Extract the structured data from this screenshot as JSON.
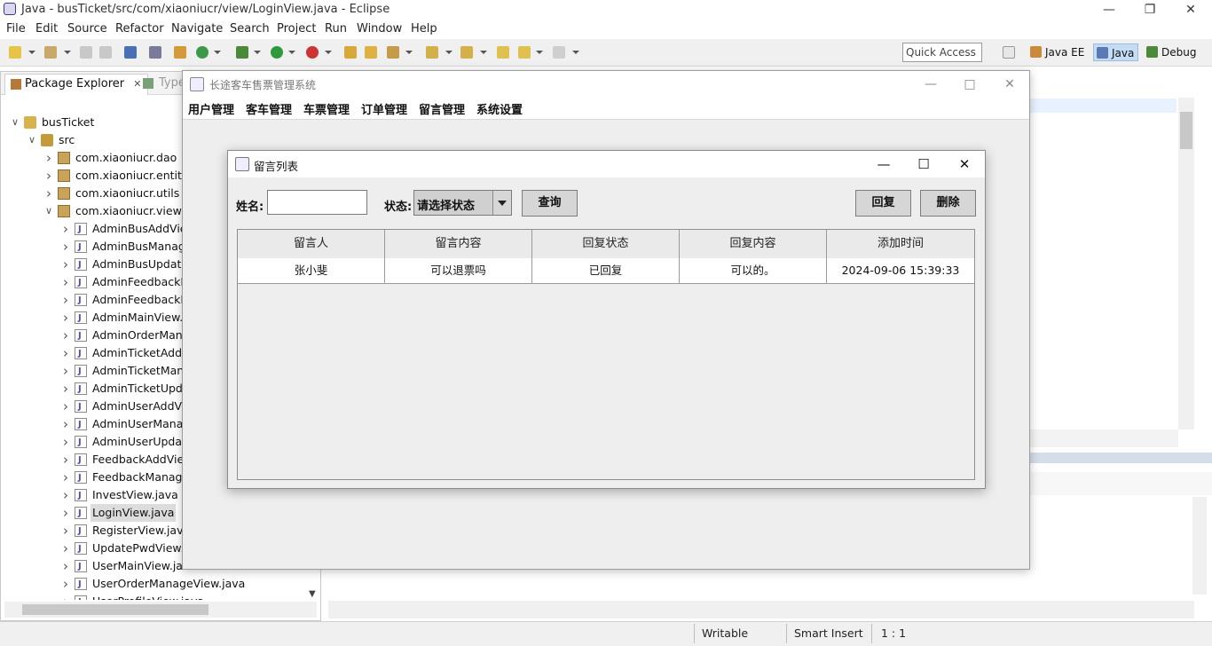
{
  "eclipse": {
    "window_title": "Java - busTicket/src/com/xiaoniucr/view/LoginView.java - Eclipse",
    "menu": [
      "File",
      "Edit",
      "Source",
      "Refactor",
      "Navigate",
      "Search",
      "Project",
      "Run",
      "Window",
      "Help"
    ],
    "quick_access": "Quick Access",
    "perspectives": [
      "Java EE",
      "Java",
      "Debug"
    ],
    "package_explorer": {
      "tab_label": "Package Explorer",
      "tab_close": "✕",
      "second_tab_label": "Type",
      "tree": [
        {
          "label": "busTicket",
          "level": 0,
          "expanded": true,
          "icon": "project-icon"
        },
        {
          "label": "src",
          "level": 1,
          "expanded": true,
          "icon": "source-folder-icon"
        },
        {
          "label": "com.xiaoniucr.dao",
          "level": 2,
          "expanded": false,
          "icon": "package-icon"
        },
        {
          "label": "com.xiaoniucr.entity",
          "level": 2,
          "expanded": false,
          "icon": "package-icon"
        },
        {
          "label": "com.xiaoniucr.utils",
          "level": 2,
          "expanded": false,
          "icon": "package-icon"
        },
        {
          "label": "com.xiaoniucr.view",
          "level": 2,
          "expanded": true,
          "icon": "package-icon"
        },
        {
          "label": "AdminBusAddVie",
          "level": 3,
          "expanded": false,
          "icon": "java-file-icon"
        },
        {
          "label": "AdminBusManag",
          "level": 3,
          "expanded": false,
          "icon": "java-file-icon"
        },
        {
          "label": "AdminBusUpdate",
          "level": 3,
          "expanded": false,
          "icon": "java-file-icon"
        },
        {
          "label": "AdminFeedbackM",
          "level": 3,
          "expanded": false,
          "icon": "java-file-icon"
        },
        {
          "label": "AdminFeedbackR",
          "level": 3,
          "expanded": false,
          "icon": "java-file-icon"
        },
        {
          "label": "AdminMainView.j",
          "level": 3,
          "expanded": false,
          "icon": "java-file-icon"
        },
        {
          "label": "AdminOrderMana",
          "level": 3,
          "expanded": false,
          "icon": "java-file-icon"
        },
        {
          "label": "AdminTicketAddV",
          "level": 3,
          "expanded": false,
          "icon": "java-file-icon"
        },
        {
          "label": "AdminTicketMana",
          "level": 3,
          "expanded": false,
          "icon": "java-file-icon"
        },
        {
          "label": "AdminTicketUpda",
          "level": 3,
          "expanded": false,
          "icon": "java-file-icon"
        },
        {
          "label": "AdminUserAddVi",
          "level": 3,
          "expanded": false,
          "icon": "java-file-icon"
        },
        {
          "label": "AdminUserManag",
          "level": 3,
          "expanded": false,
          "icon": "java-file-icon"
        },
        {
          "label": "AdminUserUpdat",
          "level": 3,
          "expanded": false,
          "icon": "java-file-icon"
        },
        {
          "label": "FeedbackAddView",
          "level": 3,
          "expanded": false,
          "icon": "java-file-icon"
        },
        {
          "label": "FeedbackManage",
          "level": 3,
          "expanded": false,
          "icon": "java-file-icon"
        },
        {
          "label": "InvestView.java",
          "level": 3,
          "expanded": false,
          "icon": "java-file-icon"
        },
        {
          "label": "LoginView.java",
          "level": 3,
          "expanded": false,
          "icon": "java-file-icon",
          "selected": true
        },
        {
          "label": "RegisterView.java",
          "level": 3,
          "expanded": false,
          "icon": "java-file-icon"
        },
        {
          "label": "UpdatePwdView.j",
          "level": 3,
          "expanded": false,
          "icon": "java-file-icon"
        },
        {
          "label": "UserMainView.java",
          "level": 3,
          "expanded": false,
          "icon": "java-file-icon"
        },
        {
          "label": "UserOrderManageView.java",
          "level": 3,
          "expanded": false,
          "icon": "java-file-icon"
        },
        {
          "label": "UserProfileView.java",
          "level": 3,
          "expanded": false,
          "icon": "java-file-icon"
        }
      ]
    },
    "status_bar": {
      "writable": "Writable",
      "insert_mode": "Smart Insert",
      "position": "1 : 1"
    }
  },
  "app": {
    "window_title": "长途客车售票管理系统",
    "menu": [
      "用户管理",
      "客车管理",
      "车票管理",
      "订单管理",
      "留言管理",
      "系统设置"
    ]
  },
  "feedback_frame": {
    "title": "留言列表",
    "name_label": "姓名:",
    "name_value": "",
    "status_label": "状态:",
    "status_selected": "请选择状态",
    "query_button": "查询",
    "reply_button": "回复",
    "delete_button": "删除",
    "columns": [
      "留言人",
      "留言内容",
      "回复状态",
      "回复内容",
      "添加时间"
    ],
    "rows": [
      [
        "张小斐",
        "可以退票吗",
        "已回复",
        "可以的。",
        "2024-09-06 15:39:33"
      ]
    ]
  },
  "colors": {
    "accent": "#c5dcf5",
    "selection": "#dcdcdc"
  }
}
